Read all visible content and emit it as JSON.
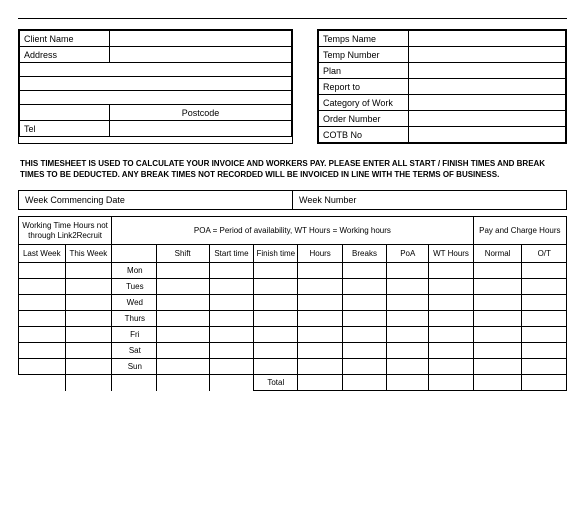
{
  "client": {
    "client_name_label": "Client Name",
    "address_label": "Address",
    "postcode_label": "Postcode",
    "tel_label": "Tel",
    "client_name": "",
    "address1": "",
    "address2": "",
    "address3": "",
    "address4": "",
    "postcode_pre": "",
    "postcode": "",
    "tel": ""
  },
  "temp": {
    "temps_name_label": "Temps Name",
    "temp_number_label": "Temp Number",
    "plan_label": "Plan",
    "report_to_label": "Report to",
    "category_label": "Category of Work",
    "order_number_label": "Order Number",
    "cotb_label": "COTB No",
    "temps_name": "",
    "temp_number": "",
    "plan": "",
    "report_to": "",
    "category": "",
    "order_number": "",
    "cotb": ""
  },
  "notice": "THIS TIMESHEET IS USED TO CALCULATE YOUR INVOICE AND WORKERS PAY. PLEASE ENTER ALL START / FINISH TIMES AND BREAK TIMES TO BE DEDUCTED. ANY BREAK TIMES NOT RECORDED WILL BE INVOICED IN LINE WITH THE TERMS OF BUSINESS.",
  "week": {
    "commencing_label": "Week Commencing Date",
    "number_label": "Week Number",
    "commencing": "",
    "number": ""
  },
  "headings": {
    "wt_hours_title": "Working Time Hours not through Link2Recruit",
    "legend": "POA = Period of availability, WT Hours = Working hours",
    "pay_charge_title": "Pay and Charge Hours",
    "last_week": "Last Week",
    "this_week": "This Week",
    "shift": "Shift",
    "start": "Start time",
    "finish": "Finish time",
    "hours": "Hours",
    "breaks": "Breaks",
    "poa": "PoA",
    "wt_hours": "WT Hours",
    "normal": "Normal",
    "ot": "O/T",
    "total": "Total"
  },
  "days": [
    "Mon",
    "Tues",
    "Wed",
    "Thurs",
    "Fri",
    "Sat",
    "Sun"
  ],
  "rows": [
    {
      "last": "",
      "this": "",
      "shift": "",
      "start": "",
      "finish": "",
      "hours": "",
      "breaks": "",
      "poa": "",
      "wt": "",
      "normal": "",
      "ot": ""
    },
    {
      "last": "",
      "this": "",
      "shift": "",
      "start": "",
      "finish": "",
      "hours": "",
      "breaks": "",
      "poa": "",
      "wt": "",
      "normal": "",
      "ot": ""
    },
    {
      "last": "",
      "this": "",
      "shift": "",
      "start": "",
      "finish": "",
      "hours": "",
      "breaks": "",
      "poa": "",
      "wt": "",
      "normal": "",
      "ot": ""
    },
    {
      "last": "",
      "this": "",
      "shift": "",
      "start": "",
      "finish": "",
      "hours": "",
      "breaks": "",
      "poa": "",
      "wt": "",
      "normal": "",
      "ot": ""
    },
    {
      "last": "",
      "this": "",
      "shift": "",
      "start": "",
      "finish": "",
      "hours": "",
      "breaks": "",
      "poa": "",
      "wt": "",
      "normal": "",
      "ot": ""
    },
    {
      "last": "",
      "this": "",
      "shift": "",
      "start": "",
      "finish": "",
      "hours": "",
      "breaks": "",
      "poa": "",
      "wt": "",
      "normal": "",
      "ot": ""
    },
    {
      "last": "",
      "this": "",
      "shift": "",
      "start": "",
      "finish": "",
      "hours": "",
      "breaks": "",
      "poa": "",
      "wt": "",
      "normal": "",
      "ot": ""
    }
  ],
  "totals": {
    "hours": "",
    "breaks": "",
    "poa": "",
    "wt": "",
    "normal": "",
    "ot": ""
  }
}
